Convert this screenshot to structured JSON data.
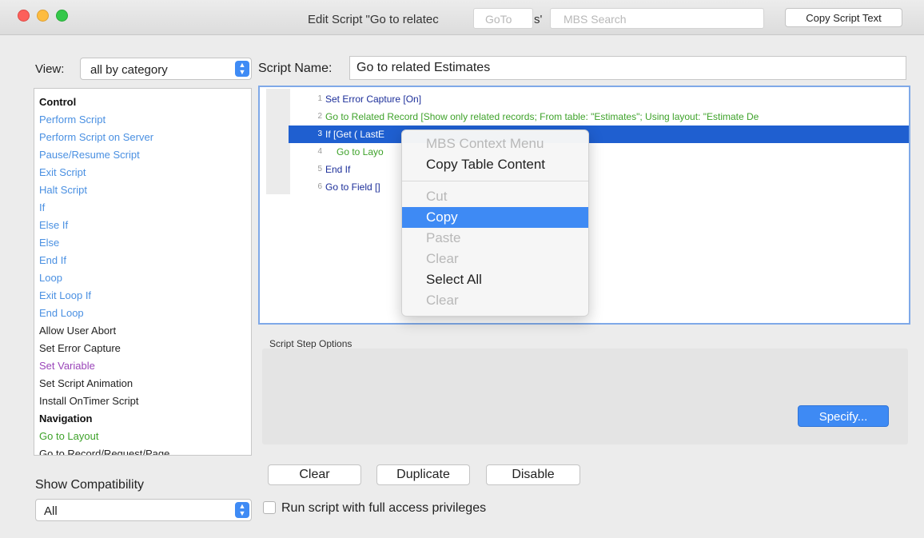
{
  "window": {
    "title_prefix": "Edit Script \"Go to relatec",
    "title_tail": "s'",
    "goto_placeholder": "GoTo",
    "search_placeholder": "MBS Search",
    "copy_script_text_label": "Copy Script Text"
  },
  "view": {
    "label": "View:",
    "value": "all by category"
  },
  "script_name": {
    "label": "Script Name:",
    "value": "Go to related Estimates"
  },
  "steps": [
    {
      "label": "Control",
      "cls": "c-head"
    },
    {
      "label": "Perform Script",
      "cls": "c-blue"
    },
    {
      "label": "Perform Script on Server",
      "cls": "c-blue"
    },
    {
      "label": "Pause/Resume Script",
      "cls": "c-blue"
    },
    {
      "label": "Exit Script",
      "cls": "c-blue"
    },
    {
      "label": "Halt Script",
      "cls": "c-blue"
    },
    {
      "label": "If",
      "cls": "c-blue"
    },
    {
      "label": "Else If",
      "cls": "c-blue"
    },
    {
      "label": "Else",
      "cls": "c-blue"
    },
    {
      "label": "End If",
      "cls": "c-blue"
    },
    {
      "label": "Loop",
      "cls": "c-blue"
    },
    {
      "label": "Exit Loop If",
      "cls": "c-blue"
    },
    {
      "label": "End Loop",
      "cls": "c-blue"
    },
    {
      "label": "Allow User Abort",
      "cls": "c-black"
    },
    {
      "label": "Set Error Capture",
      "cls": "c-black"
    },
    {
      "label": "Set Variable",
      "cls": "c-purple"
    },
    {
      "label": "Set Script Animation",
      "cls": "c-black"
    },
    {
      "label": "Install OnTimer Script",
      "cls": "c-black"
    },
    {
      "label": "Navigation",
      "cls": "c-head"
    },
    {
      "label": "Go to Layout",
      "cls": "c-green"
    },
    {
      "label": "Go to Record/Request/Page",
      "cls": "c-black"
    }
  ],
  "script_lines": [
    {
      "num": "1",
      "text": "Set Error Capture [On]",
      "cls": "t-navy",
      "indent": 0,
      "selected": false
    },
    {
      "num": "2",
      "text": "Go to Related Record [Show only related records; From table: \"Estimates\"; Using layout: \"Estimate De",
      "cls": "t-green",
      "indent": 0,
      "selected": false
    },
    {
      "num": "3",
      "text": "If [Get ( LastE",
      "cls": "t-blue",
      "indent": 0,
      "selected": true
    },
    {
      "num": "4",
      "text": "Go to Layo",
      "cls": "t-green",
      "indent": 1,
      "selected": false
    },
    {
      "num": "5",
      "text": "End If",
      "cls": "t-blue",
      "indent": 0,
      "selected": false
    },
    {
      "num": "6",
      "text": "Go to Field []",
      "cls": "t-navy",
      "indent": 0,
      "selected": false
    }
  ],
  "context_menu": {
    "items": [
      {
        "label": "MBS Context Menu",
        "state": "dis",
        "sep_after": false
      },
      {
        "label": "Copy Table Content",
        "state": "en",
        "sep_after": true
      },
      {
        "label": "Cut",
        "state": "dis",
        "sep_after": false
      },
      {
        "label": "Copy",
        "state": "hl",
        "sep_after": false
      },
      {
        "label": "Paste",
        "state": "dis",
        "sep_after": false
      },
      {
        "label": "Clear",
        "state": "dis",
        "sep_after": false
      },
      {
        "label": "Select All",
        "state": "en",
        "sep_after": false
      },
      {
        "label": "Clear",
        "state": "dis",
        "sep_after": false
      }
    ]
  },
  "options": {
    "label": "Script Step Options",
    "specify_label": "Specify..."
  },
  "buttons": {
    "clear": "Clear",
    "duplicate": "Duplicate",
    "disable": "Disable"
  },
  "privileges_label": "Run script with full access privileges",
  "compat": {
    "label": "Show Compatibility",
    "value": "All"
  },
  "colors": {
    "accent": "#3e8af4",
    "selection": "#1f5fd0",
    "step_blue": "#4a90e2",
    "step_green": "#3ea22a",
    "step_purple": "#9a45b9"
  }
}
